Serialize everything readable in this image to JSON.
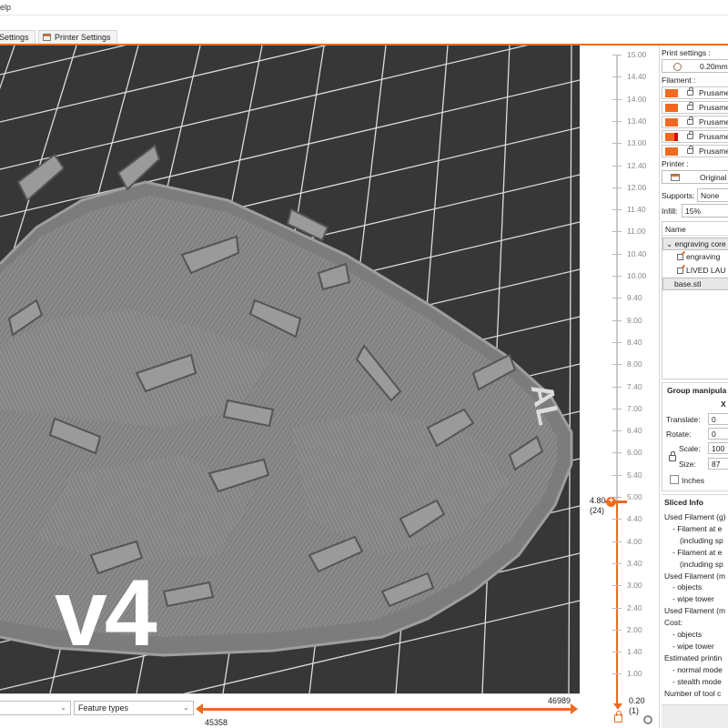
{
  "menubar": {
    "visible_text": "elp"
  },
  "tabs": [
    {
      "label": "Settings"
    },
    {
      "label": "Printer Settings"
    }
  ],
  "viewport": {
    "overlay_text": "v4",
    "background_text": "AL"
  },
  "bottom_bar": {
    "view_select_value": "",
    "legend_select_value": "Feature types",
    "horizontal_slider": {
      "left_value": "45358",
      "right_value": "46989"
    }
  },
  "layer_slider": {
    "tick_labels": [
      "15.00",
      "14.40",
      "14.00",
      "13.40",
      "13.00",
      "12.40",
      "12.00",
      "11.40",
      "11.00",
      "10.40",
      "10.00",
      "9.40",
      "9.00",
      "8.40",
      "8.00",
      "7.40",
      "7.00",
      "6.40",
      "6.00",
      "5.40",
      "5.00",
      "4.40",
      "4.00",
      "3.40",
      "3.00",
      "2.40",
      "2.00",
      "1.40",
      "1.00"
    ],
    "upper": {
      "height": "4.80",
      "layer": "(24)"
    },
    "lower": {
      "height": "0.20",
      "layer": "(1)"
    }
  },
  "sidebar": {
    "print_settings_label": "Print settings :",
    "print_settings_value": "0.20mm",
    "filament_label": "Filament :",
    "filaments": [
      {
        "name": "Prusame",
        "color": "#ed6b21"
      },
      {
        "name": "Prusame",
        "color": "#ed6b21"
      },
      {
        "name": "Prusame",
        "color": "#ed6b21"
      },
      {
        "name": "Prusame",
        "color": "#d20b0b"
      },
      {
        "name": "Prusame",
        "color": "#ed6b21"
      }
    ],
    "printer_label": "Printer :",
    "printer_value": "Original",
    "supports_label": "Supports:",
    "supports_value": "None",
    "infill_label": "Infill:",
    "infill_value": "15%",
    "object_list": {
      "header": "Name",
      "rows": [
        {
          "label": "engraving core"
        },
        {
          "label": "engraving"
        },
        {
          "label": "LIVED LAU"
        },
        {
          "label": "base.stl"
        }
      ]
    },
    "group_manipulation": {
      "title": "Group manipula",
      "axis_x": "X",
      "translate_label": "Translate:",
      "translate_x": "0",
      "rotate_label": "Rotate:",
      "rotate_x": "0",
      "scale_label": "Scale:",
      "scale_x": "100",
      "size_label": "Size:",
      "size_x": "87",
      "inches_label": "Inches"
    },
    "sliced_info": {
      "title": "Sliced Info",
      "lines": [
        "Used Filament (g)",
        "- Filament at e",
        "(including sp",
        "- Filament at e",
        "(including sp",
        "Used Filament (m",
        "- objects",
        "- wipe tower",
        "Used Filament (m",
        "Cost:",
        "- objects",
        "- wipe tower",
        "Estimated printin",
        "- normal mode",
        "- stealth mode",
        "Number of tool c"
      ]
    }
  },
  "colors": {
    "accent": "#ed6b21",
    "viewport_bg": "#373737",
    "bed_grid": "#ffffff"
  }
}
